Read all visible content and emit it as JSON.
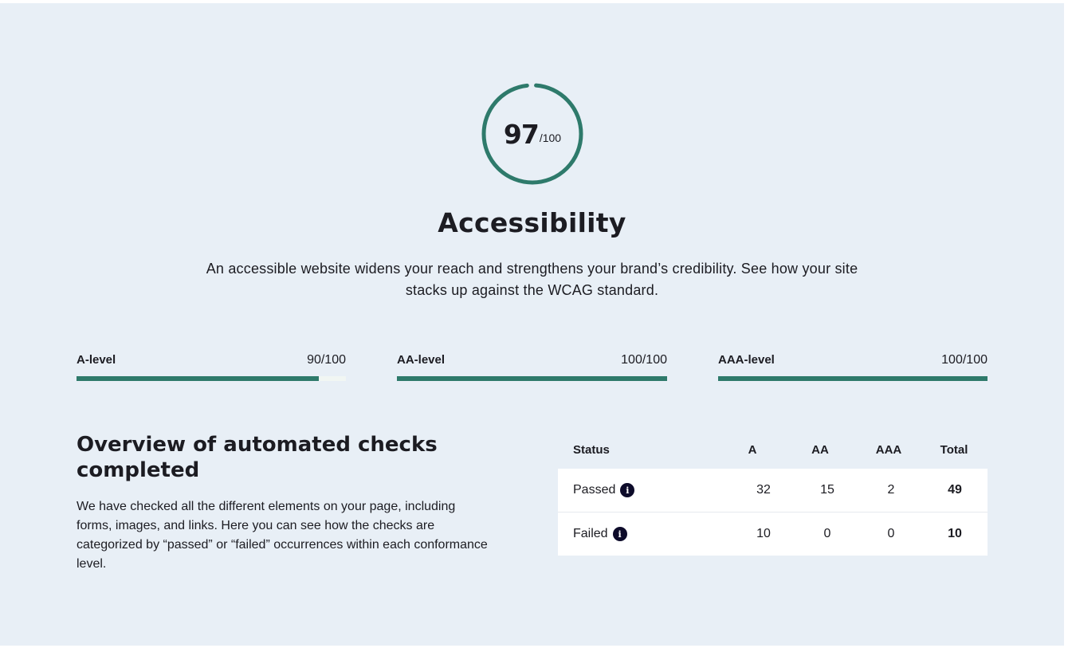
{
  "score": {
    "value": "97",
    "max": "/100",
    "fraction": 0.97,
    "ring_color": "#2e7a6b"
  },
  "title": "Accessibility",
  "description": "An accessible website widens your reach and strengthens your brand’s credibility. See how your site stacks up against the WCAG standard.",
  "levels": [
    {
      "name": "A-level",
      "score": "90/100",
      "fraction": 0.9
    },
    {
      "name": "AA-level",
      "score": "100/100",
      "fraction": 1.0
    },
    {
      "name": "AAA-level",
      "score": "100/100",
      "fraction": 1.0
    }
  ],
  "overview": {
    "title": "Overview of automated checks completed",
    "text": "We have checked all the different elements on your page, including forms, images, and links. Here you can see how the checks are categorized by “passed” or “failed” occurrences within each conformance level."
  },
  "table": {
    "headers": {
      "status": "Status",
      "a": "A",
      "aa": "AA",
      "aaa": "AAA",
      "total": "Total"
    },
    "rows": [
      {
        "status": "Passed",
        "a": "32",
        "aa": "15",
        "aaa": "2",
        "total": "49"
      },
      {
        "status": "Failed",
        "a": "10",
        "aa": "0",
        "aaa": "0",
        "total": "10"
      }
    ],
    "info_icon": "info-icon"
  },
  "colors": {
    "background": "#e8eff6",
    "accent": "#2e7a6b",
    "info_icon": "#0d0b2a"
  }
}
